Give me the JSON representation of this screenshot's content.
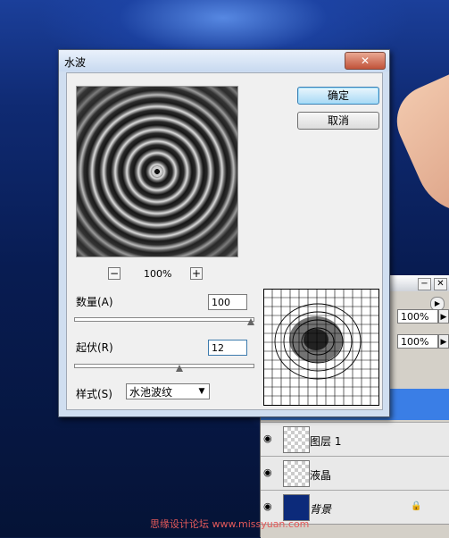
{
  "dialog": {
    "title": "水波",
    "close_label": "✕",
    "ok_label": "确定",
    "cancel_label": "取消",
    "zoom": {
      "minus": "−",
      "plus": "+",
      "level": "100%"
    },
    "amount": {
      "label": "数量(A)",
      "value": "100",
      "slider_fraction": 1.0
    },
    "ridges": {
      "label": "起伏(R)",
      "value": "12",
      "slider_fraction": 0.6
    },
    "style": {
      "label": "样式(S)",
      "value": "水池波纹"
    }
  },
  "layers_panel": {
    "opacity": "100%",
    "fill": "100%",
    "layers": [
      {
        "name": "图层 1"
      },
      {
        "name": "液晶"
      },
      {
        "name": "背景"
      }
    ]
  },
  "watermark": "思缘设计论坛 www.missyuan.com"
}
